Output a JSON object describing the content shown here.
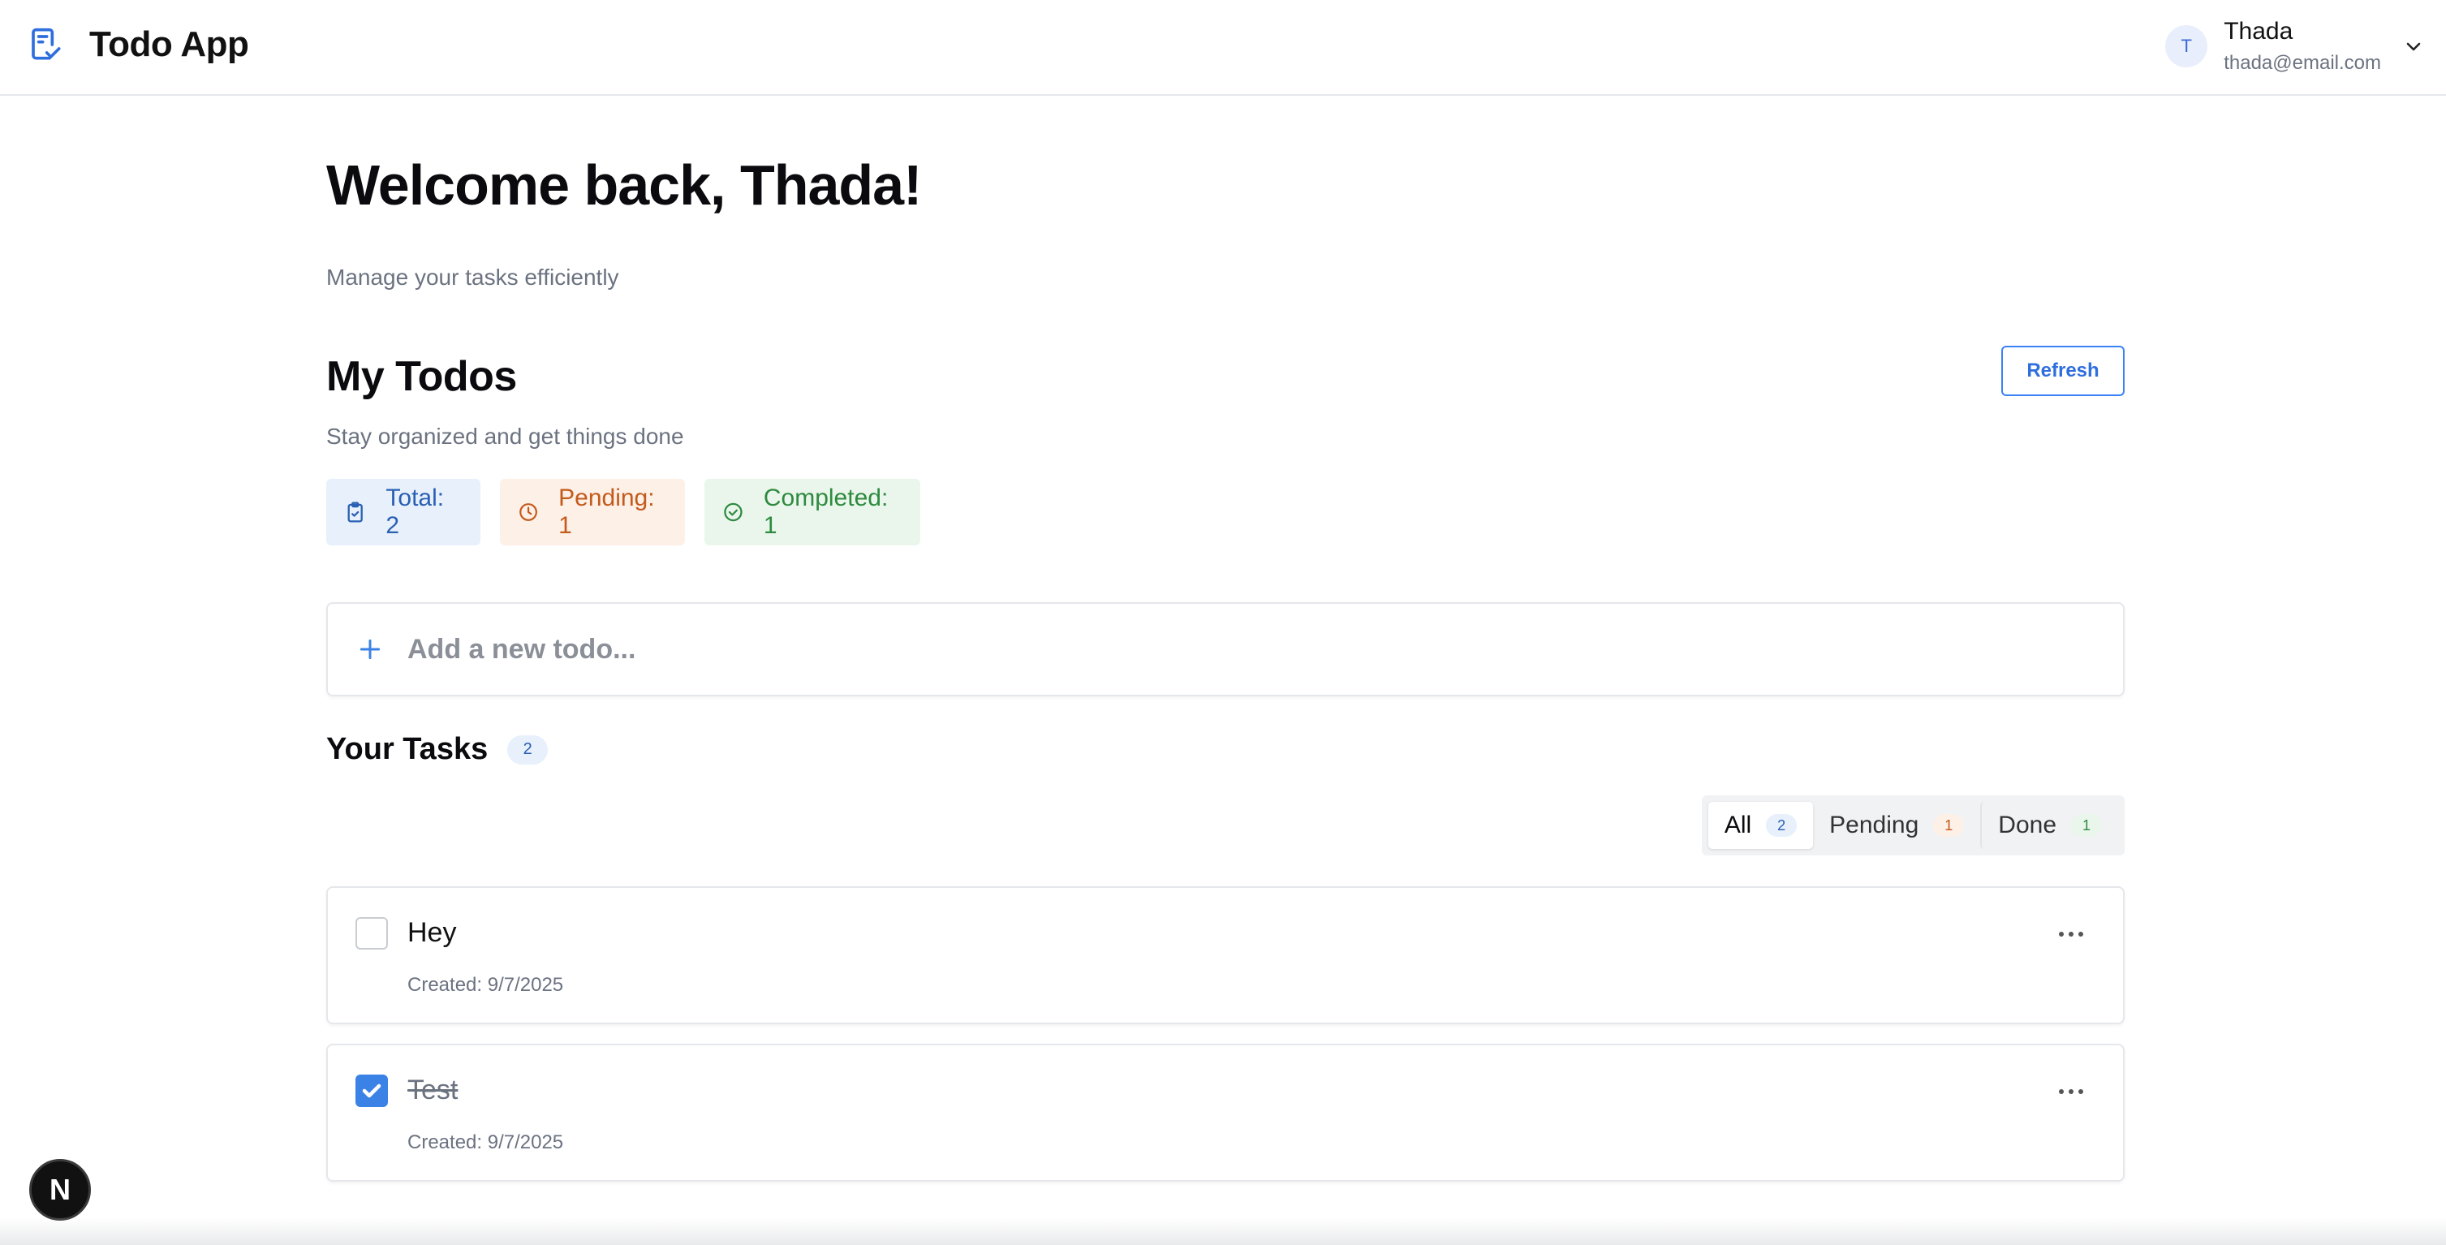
{
  "header": {
    "app_title": "Todo App",
    "user": {
      "initial": "T",
      "name": "Thada",
      "email": "thada@email.com"
    }
  },
  "welcome": {
    "title": "Welcome back, Thada!",
    "subtitle": "Manage your tasks efficiently"
  },
  "todos": {
    "title": "My Todos",
    "subtitle": "Stay organized and get things done",
    "refresh_label": "Refresh",
    "stats": {
      "total": "Total: 2",
      "pending": "Pending: 1",
      "completed": "Completed: 1"
    },
    "add_placeholder": "Add a new todo..."
  },
  "tasks": {
    "title": "Your Tasks",
    "count": "2",
    "filters": [
      {
        "label": "All",
        "count": "2"
      },
      {
        "label": "Pending",
        "count": "1"
      },
      {
        "label": "Done",
        "count": "1"
      }
    ],
    "items": [
      {
        "title": "Hey",
        "created": "Created: 9/7/2025",
        "completed": false
      },
      {
        "title": "Test",
        "created": "Created: 9/7/2025",
        "completed": true
      }
    ]
  },
  "dev_badge": "N",
  "colors": {
    "accent": "#3b82e6",
    "total_bg": "#e7f0fb",
    "pending_bg": "#fdf0e6",
    "completed_bg": "#eaf6ec"
  }
}
